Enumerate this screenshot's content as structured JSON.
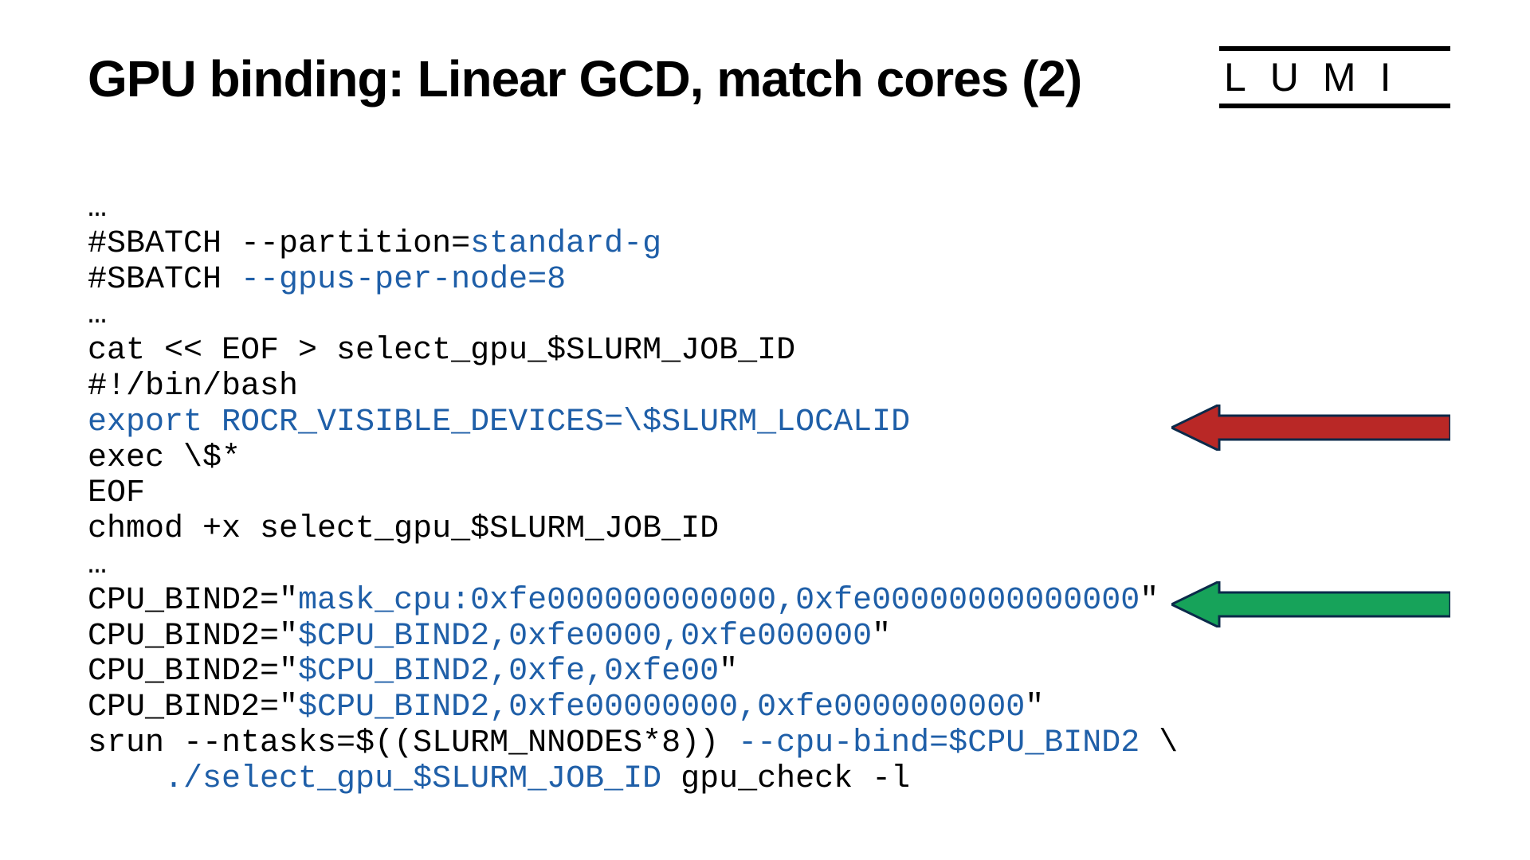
{
  "title": "GPU binding: Linear GCD, match cores (2)",
  "logo_text": "LUMI",
  "code": {
    "l01": "…",
    "l02a": "#SBATCH --partition=",
    "l02b": "standard-g",
    "l03a": "#SBATCH ",
    "l03b": "--gpus-per-node=8",
    "l04": "…",
    "l05": "cat << EOF > select_gpu_$SLURM_JOB_ID",
    "l06": "#!/bin/bash",
    "l07": "export ROCR_VISIBLE_DEVICES=\\$SLURM_LOCALID",
    "l08": "exec \\$*",
    "l09": "EOF",
    "l10": "chmod +x select_gpu_$SLURM_JOB_ID",
    "l11": "…",
    "l12a": "CPU_BIND2=\"",
    "l12b": "mask_cpu:0xfe000000000000,0xfe00000000000000",
    "l12c": "\"",
    "l13a": "CPU_BIND2=\"",
    "l13b": "$CPU_BIND2,0xfe0000,0xfe000000",
    "l13c": "\"",
    "l14a": "CPU_BIND2=\"",
    "l14b": "$CPU_BIND2,0xfe,0xfe00",
    "l14c": "\"",
    "l15a": "CPU_BIND2=\"",
    "l15b": "$CPU_BIND2,0xfe00000000,0xfe0000000000",
    "l15c": "\"",
    "l16a": "srun --ntasks=$((SLURM_NNODES*8)) ",
    "l16b": "--cpu-bind=$CPU_BIND2",
    "l16c": " \\",
    "l17a": "    ",
    "l17b": "./select_gpu_$SLURM_JOB_ID",
    "l17c": " gpu_check -l"
  },
  "arrows": {
    "red": {
      "fill": "#b92826",
      "stroke": "#0b2a4a"
    },
    "green": {
      "fill": "#17a35a",
      "stroke": "#0b2a4a"
    }
  }
}
